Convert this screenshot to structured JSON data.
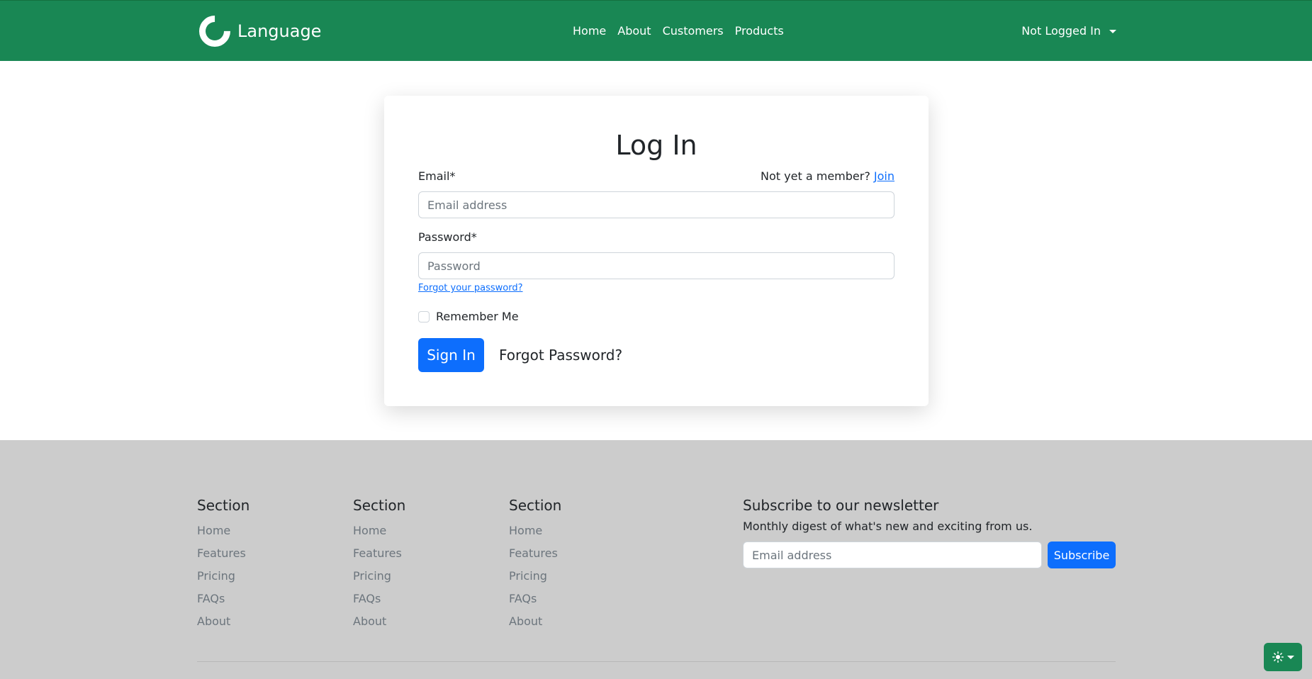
{
  "navbar": {
    "brand": "Language",
    "links": [
      "Home",
      "About",
      "Customers",
      "Products"
    ],
    "user_menu": "Not Logged In"
  },
  "login": {
    "title": "Log In",
    "email_label": "Email*",
    "member_prompt": "Not yet a member?",
    "join_link": "Join",
    "email_placeholder": "Email address",
    "password_label": "Password*",
    "password_placeholder": "Password",
    "forgot_link": "Forgot your password?",
    "remember_label": "Remember Me",
    "signin_label": "Sign In",
    "forgot_password": "Forgot Password?"
  },
  "footer": {
    "sections": [
      {
        "title": "Section",
        "links": [
          "Home",
          "Features",
          "Pricing",
          "FAQs",
          "About"
        ]
      },
      {
        "title": "Section",
        "links": [
          "Home",
          "Features",
          "Pricing",
          "FAQs",
          "About"
        ]
      },
      {
        "title": "Section",
        "links": [
          "Home",
          "Features",
          "Pricing",
          "FAQs",
          "About"
        ]
      }
    ],
    "newsletter": {
      "title": "Subscribe to our newsletter",
      "description": "Monthly digest of what's new and exciting from us.",
      "placeholder": "Email address",
      "button": "Subscribe"
    }
  },
  "theme_toggle": {
    "icon": "sun-icon"
  },
  "colors": {
    "navbar_bg": "#198754",
    "primary": "#0d6efd",
    "footer_bg": "#cccccc"
  }
}
